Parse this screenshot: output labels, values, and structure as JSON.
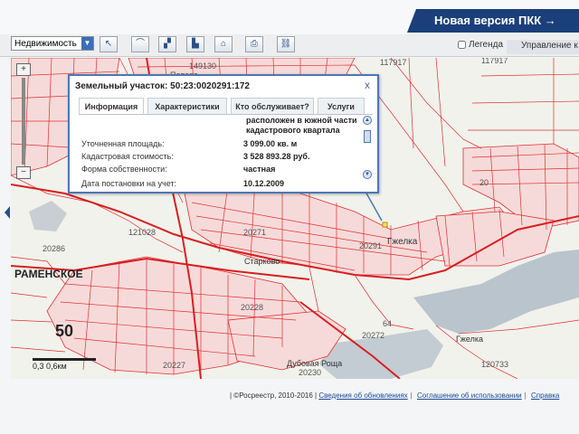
{
  "header": {
    "new_version_label": "Новая версия ПКК →"
  },
  "toolbar": {
    "category_select": "Недвижимость",
    "legend_label": "Легенда",
    "manage_label": "Управление к"
  },
  "map": {
    "labels": {
      "city": "РАМЕНСКОЕ",
      "region_num": "50",
      "starkovo": "Старково",
      "gzhelka": "Гжелка",
      "gzhelka2": "Гжелка",
      "dubovaya": "Дубовая Роща",
      "n149130": "149130",
      "n117917": "117917",
      "n121028": "121028",
      "n20286": "20286",
      "n20271": "20271",
      "n20291": "20291",
      "n20228": "20228",
      "n20227": "20227",
      "n20272": "20272",
      "n20230": "20230",
      "n120733": "120733",
      "n64": "64",
      "n20": "20",
      "popova": "Попова"
    },
    "scale_label": "0,3 0,6км"
  },
  "popup": {
    "title": "Земельный участок: 50:23:0020291:172",
    "close": "X",
    "tabs": [
      "Информация",
      "Характеристики",
      "Кто обслуживает?",
      "Услуги"
    ],
    "top_text": "расположен в южной части кадастрового квартала",
    "rows": [
      {
        "k": "Уточненная площадь:",
        "v": "3 099.00 кв. м"
      },
      {
        "k": "Кадастровая стоимость:",
        "v": "3 528 893.28 руб."
      },
      {
        "k": "Форма собственности:",
        "v": "частная"
      },
      {
        "k": "Дата постановки на учет:",
        "v": "10.12.2009"
      }
    ]
  },
  "footer": {
    "copyright": "| ©Росреестр, 2010-2016 |",
    "link_updates": "Сведения об обновлениях",
    "link_terms": "Соглашение об использовании",
    "link_help": "Справка"
  },
  "colors": {
    "accent": "#1a3f7a",
    "map_lines": "#e03030",
    "popup_border": "#4b78b5"
  }
}
